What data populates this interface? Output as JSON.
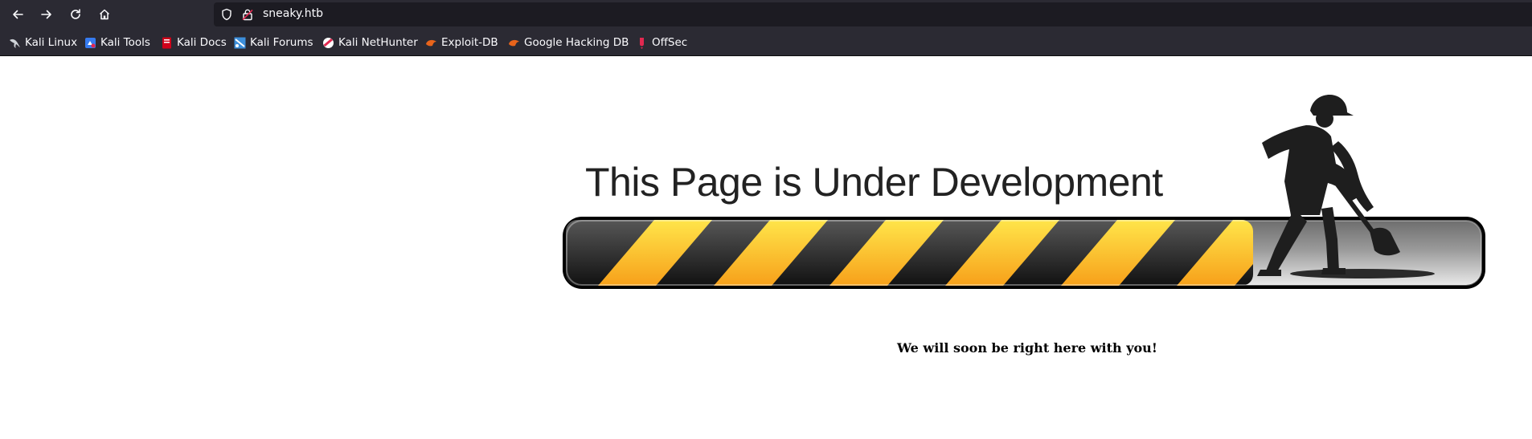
{
  "browser": {
    "url": "sneaky.htb"
  },
  "bookmarks": [
    {
      "label": "Kali Linux",
      "icon": "kali-dragon-icon"
    },
    {
      "label": "Kali Tools",
      "icon": "kali-tools-icon"
    },
    {
      "label": "Kali Docs",
      "icon": "kali-docs-icon"
    },
    {
      "label": "Kali Forums",
      "icon": "kali-forums-icon"
    },
    {
      "label": "Kali NetHunter",
      "icon": "kali-nethunter-icon"
    },
    {
      "label": "Exploit-DB",
      "icon": "exploit-db-icon"
    },
    {
      "label": "Google Hacking DB",
      "icon": "exploit-db-icon"
    },
    {
      "label": "OffSec",
      "icon": "offsec-icon"
    }
  ],
  "page": {
    "heading": "This Page is Under Development",
    "message": "We will soon be right here with you!",
    "progress_fraction": 0.75,
    "colors": {
      "stripe_yellow": "#f5c518",
      "stripe_dark": "#2b2b2b",
      "worker": "#1e1e1e"
    }
  }
}
